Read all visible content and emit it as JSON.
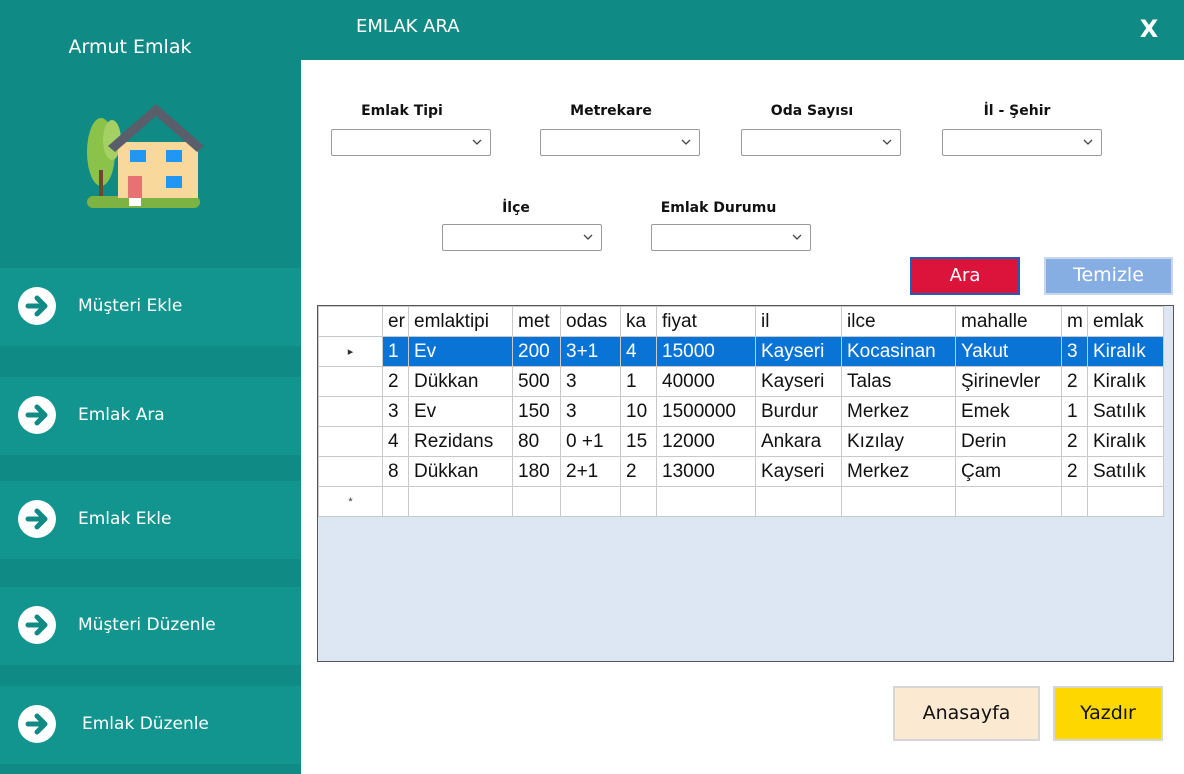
{
  "sidebar": {
    "brand": "Armut Emlak",
    "items": [
      {
        "label": "Müşteri Ekle"
      },
      {
        "label": "Emlak Ara"
      },
      {
        "label": "Emlak Ekle"
      },
      {
        "label": "Müşteri Düzenle"
      },
      {
        "label": "Emlak Düzenle"
      }
    ]
  },
  "window": {
    "title": "EMLAK ARA",
    "close": "X"
  },
  "filters": {
    "emlak_tipi": {
      "label": "Emlak Tipi",
      "value": ""
    },
    "metrekare": {
      "label": "Metrekare",
      "value": ""
    },
    "oda_sayisi": {
      "label": "Oda Sayısı",
      "value": ""
    },
    "il_sehir": {
      "label": "İl - Şehir",
      "value": ""
    },
    "ilce": {
      "label": "İlçe",
      "value": ""
    },
    "emlak_durumu": {
      "label": "Emlak Durumu",
      "value": ""
    }
  },
  "actions": {
    "search": "Ara",
    "clear": "Temizle",
    "home": "Anasayfa",
    "print": "Yazdır"
  },
  "grid": {
    "columns": [
      "er",
      "emlaktipi",
      "met",
      "odas",
      "ka",
      "fiyat",
      "il",
      "ilce",
      "mahalle",
      "m",
      "emlak"
    ],
    "rows": [
      [
        "1",
        "Ev",
        "200",
        "3+1",
        "4",
        "15000",
        "Kayseri",
        "Kocasinan",
        "Yakut",
        "3",
        "Kiralık"
      ],
      [
        "2",
        "Dükkan",
        "500",
        "3",
        "1",
        "40000",
        "Kayseri",
        "Talas",
        "Şirinevler",
        "2",
        "Kiralık"
      ],
      [
        "3",
        "Ev",
        "150",
        "3",
        "10",
        "1500000",
        "Burdur",
        "Merkez",
        "Emek",
        "1",
        "Satılık"
      ],
      [
        "4",
        "Rezidans",
        "80",
        "0 +1",
        "15",
        "12000",
        "Ankara",
        "Kızılay",
        "Derin",
        "2",
        "Kiralık"
      ],
      [
        "8",
        "Dükkan",
        "180",
        "2+1",
        "2",
        "13000",
        "Kayseri",
        "Merkez",
        "Çam",
        "2",
        "Satılık"
      ]
    ],
    "current_row_marker": "▸",
    "new_row_marker": "*"
  },
  "colors": {
    "sidebar": "#0f8a85",
    "search_button": "#dc143c",
    "clear_button": "#87aee3",
    "home_button": "#fbe9d2",
    "print_button": "#ffd700",
    "selection": "#0a74d6"
  },
  "icons": {
    "logo": "house-icon",
    "nav": "arrow-right-circle-icon",
    "close": "close-icon",
    "dropdown": "chevron-down-icon"
  }
}
